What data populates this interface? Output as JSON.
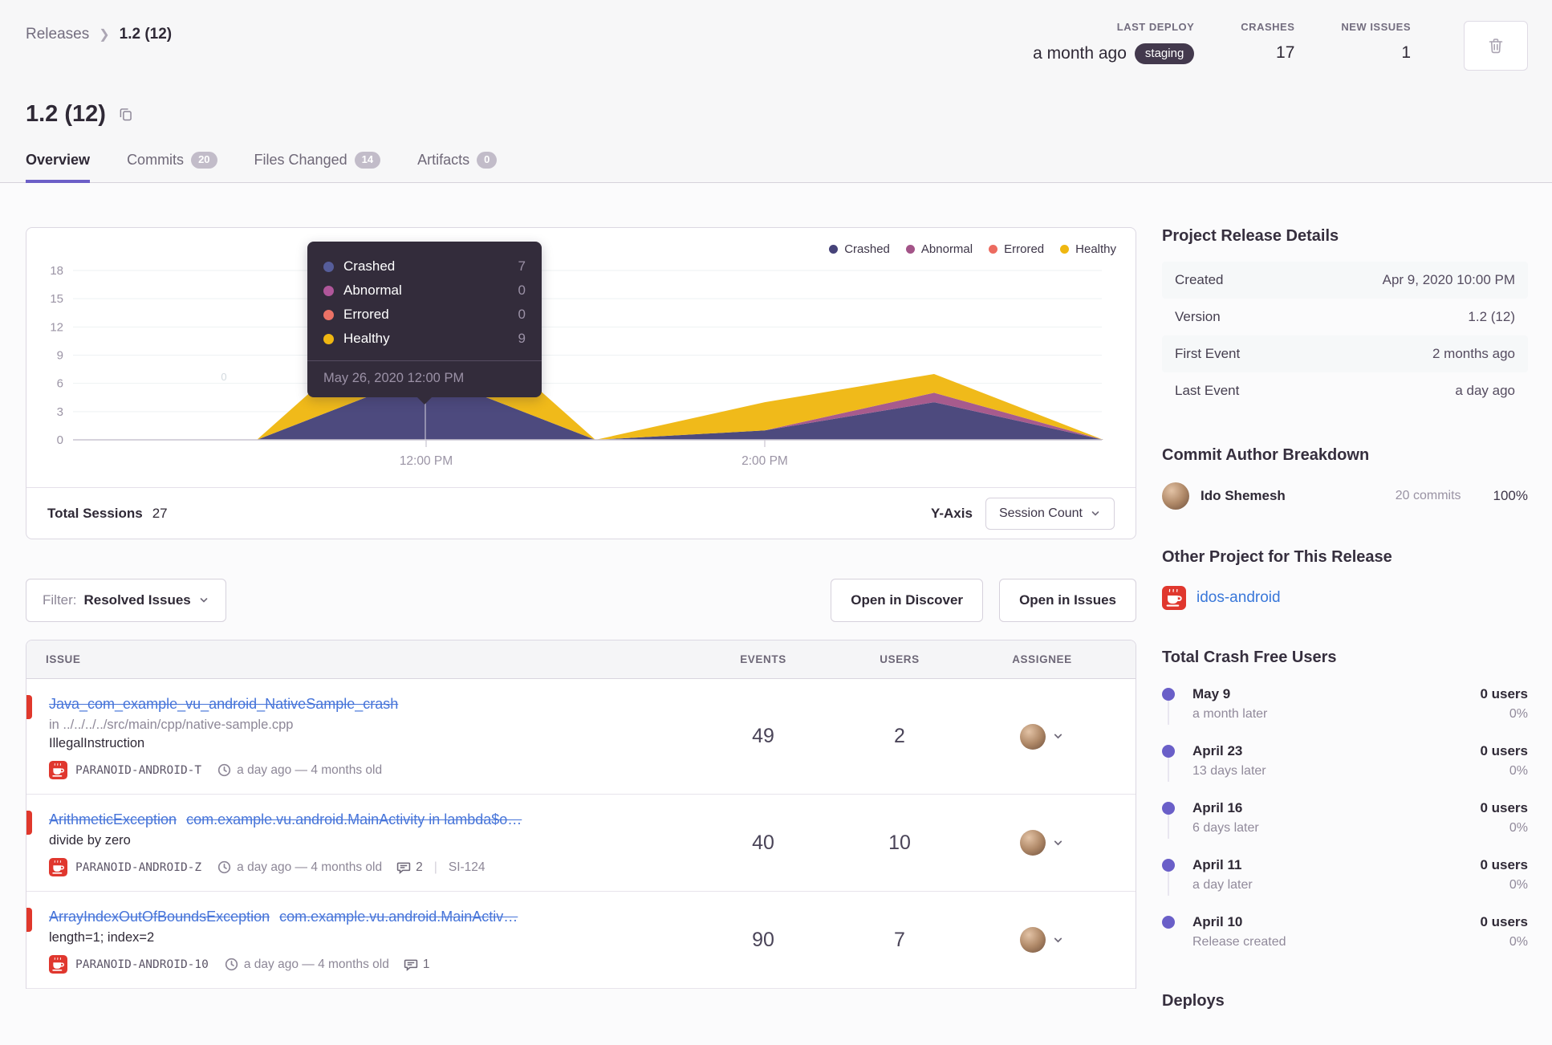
{
  "breadcrumb": {
    "root": "Releases",
    "current": "1.2 (12)"
  },
  "header_stats": {
    "last_deploy": {
      "label": "LAST DEPLOY",
      "value": "a month ago",
      "env": "staging"
    },
    "crashes": {
      "label": "CRASHES",
      "value": "17"
    },
    "new_issues": {
      "label": "NEW ISSUES",
      "value": "1"
    }
  },
  "page_title": "1.2 (12)",
  "tabs": [
    {
      "label": "Overview",
      "badge": "",
      "active": true
    },
    {
      "label": "Commits",
      "badge": "20"
    },
    {
      "label": "Files Changed",
      "badge": "14"
    },
    {
      "label": "Artifacts",
      "badge": "0"
    }
  ],
  "chart_data": {
    "type": "area",
    "stacked": true,
    "x_hours": [
      10,
      11,
      12,
      13,
      14,
      15,
      16
    ],
    "series": [
      {
        "name": "Crashed",
        "color": "#464379",
        "values": [
          0,
          0,
          7,
          0,
          1,
          4,
          0
        ]
      },
      {
        "name": "Abnormal",
        "color": "#a35488",
        "values": [
          0,
          0,
          0,
          0,
          0,
          1,
          0
        ]
      },
      {
        "name": "Errored",
        "color": "#ec6b60",
        "values": [
          0,
          0,
          0,
          0,
          0,
          0,
          0
        ]
      },
      {
        "name": "Healthy",
        "color": "#efb711",
        "values": [
          0,
          0,
          9,
          0,
          3,
          2,
          0
        ]
      }
    ],
    "ylim": [
      0,
      18
    ],
    "y_ticks": [
      0,
      3,
      6,
      9,
      12,
      15,
      18
    ],
    "x_tick_labels": [
      {
        "hour": 12,
        "label": "12:00 PM"
      },
      {
        "hour": 14,
        "label": "2:00 PM"
      }
    ],
    "grid": true,
    "legend_position": "top-right",
    "faint_label": "0",
    "tooltip": {
      "rows": [
        {
          "label": "Crashed",
          "value": "7",
          "color": "#565d9a"
        },
        {
          "label": "Abnormal",
          "value": "0",
          "color": "#b0569a"
        },
        {
          "label": "Errored",
          "value": "0",
          "color": "#ec7266"
        },
        {
          "label": "Healthy",
          "value": "9",
          "color": "#f0b712"
        }
      ],
      "footer": "May 26, 2020 12:00 PM"
    }
  },
  "chart_footer": {
    "total_label": "Total Sessions",
    "total_value": "27",
    "yaxis_label": "Y-Axis",
    "yaxis_value": "Session Count"
  },
  "filter_bar": {
    "prefix": "Filter:",
    "value": "Resolved Issues",
    "discover_button": "Open in Discover",
    "issues_button": "Open in Issues"
  },
  "issues_table": {
    "columns": [
      "ISSUE",
      "EVENTS",
      "USERS",
      "ASSIGNEE"
    ],
    "level_color": "#e0382c",
    "rows": [
      {
        "title": "Java_com_example_vu_android_NativeSample_crash",
        "culprit": "",
        "lines": [
          {
            "text": "in ../../../../src/main/cpp/native-sample.cpp",
            "tone": "muted"
          },
          {
            "text": "IllegalInstruction",
            "tone": "dark"
          }
        ],
        "project": "PARANOID-ANDROID-T",
        "age": "a day ago — 4 months old",
        "comments": "",
        "ref": "",
        "events": "49",
        "users": "2"
      },
      {
        "title": "ArithmeticException",
        "culprit": "com.example.vu.android.MainActivity in lambda$o…",
        "lines": [
          {
            "text": "divide by zero",
            "tone": "dark"
          }
        ],
        "project": "PARANOID-ANDROID-Z",
        "age": "a day ago — 4 months old",
        "comments": "2",
        "ref": "SI-124",
        "events": "40",
        "users": "10"
      },
      {
        "title": "ArrayIndexOutOfBoundsException",
        "culprit": "com.example.vu.android.MainActiv…",
        "lines": [
          {
            "text": "length=1; index=2",
            "tone": "dark"
          }
        ],
        "project": "PARANOID-ANDROID-10",
        "age": "a day ago — 4 months old",
        "comments": "1",
        "ref": "",
        "events": "90",
        "users": "7"
      }
    ]
  },
  "sidebar": {
    "release_details": {
      "title": "Project Release Details",
      "rows": [
        {
          "label": "Created",
          "value": "Apr 9, 2020 10:00 PM"
        },
        {
          "label": "Version",
          "value": "1.2 (12)"
        },
        {
          "label": "First Event",
          "value": "2 months ago"
        },
        {
          "label": "Last Event",
          "value": "a day ago"
        }
      ]
    },
    "commit_authors": {
      "title": "Commit Author Breakdown",
      "author": {
        "name": "Ido Shemesh",
        "commits": "20 commits",
        "percent": "100%"
      }
    },
    "other_project": {
      "title": "Other Project for This Release",
      "project": "idos-android"
    },
    "crash_free": {
      "title": "Total Crash Free Users",
      "items": [
        {
          "date": "May 9",
          "sub": "a month later",
          "users": "0 users",
          "pct": "0%"
        },
        {
          "date": "April 23",
          "sub": "13 days later",
          "users": "0 users",
          "pct": "0%"
        },
        {
          "date": "April 16",
          "sub": "6 days later",
          "users": "0 users",
          "pct": "0%"
        },
        {
          "date": "April 11",
          "sub": "a day later",
          "users": "0 users",
          "pct": "0%"
        },
        {
          "date": "April 10",
          "sub": "Release created",
          "users": "0 users",
          "pct": "0%"
        }
      ]
    },
    "deploys": {
      "title": "Deploys"
    }
  },
  "colors": {
    "accent": "#6c5fc7",
    "link_blue": "#4674d9",
    "level_red": "#e0382c",
    "env_pill": "#43394d"
  }
}
